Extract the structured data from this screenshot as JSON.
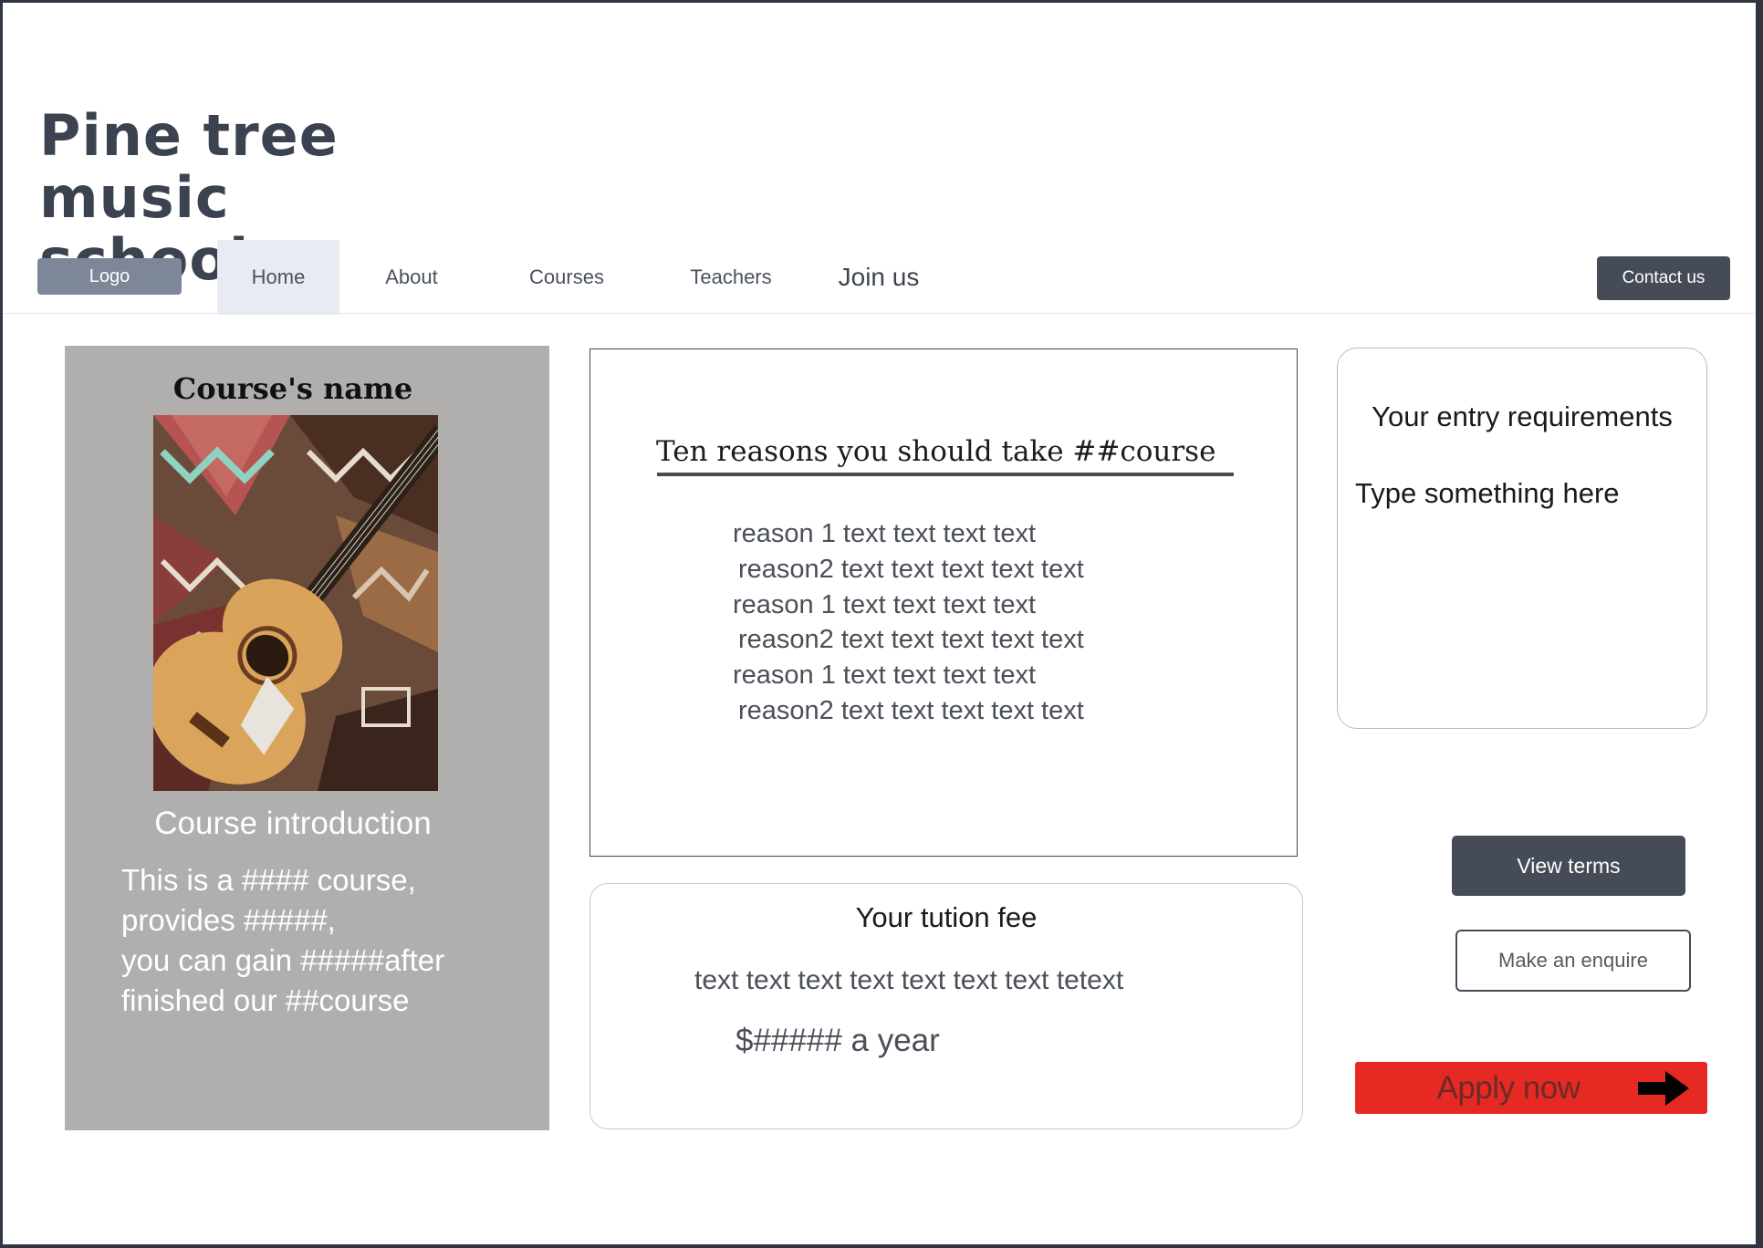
{
  "brand": {
    "line1": "Pine tree",
    "line2": "music school"
  },
  "nav": {
    "logo": "Logo",
    "items": [
      "Home",
      "About",
      "Courses",
      "Teachers",
      "Join us"
    ],
    "active": "Home",
    "contact": "Contact us"
  },
  "course": {
    "name": "Course's name",
    "intro_heading": "Course introduction",
    "intro_text": "This is a  #### course,\nprovides #####,\nyou can gain #####after\nfinished our ##course"
  },
  "reasons": {
    "title": "Ten reasons you should take ##course",
    "items": [
      "reason 1 text text text text",
      "reason2 text text text text text",
      "reason 1 text text text text",
      "reason2 text text text text text",
      "reason 1 text text text text",
      "reason2 text text text text text"
    ]
  },
  "fee": {
    "title": "Your tution fee",
    "text": "text text text text text text text tetext",
    "amount": "$##### a year"
  },
  "entry": {
    "title": "Your entry requirements",
    "placeholder": "Type something here"
  },
  "actions": {
    "view_terms": "View terms",
    "enquire": "Make an enquire",
    "apply": "Apply now"
  },
  "colors": {
    "page_frame": "#2f3642",
    "brand_text": "#3b4350",
    "dark_button": "#464c57",
    "logo_button": "#7d8797",
    "active_nav": "#e8ebf2",
    "course_card": "#b0afae",
    "apply_button": "#e62a23"
  },
  "icons": {
    "apply": "right-arrow-icon"
  }
}
